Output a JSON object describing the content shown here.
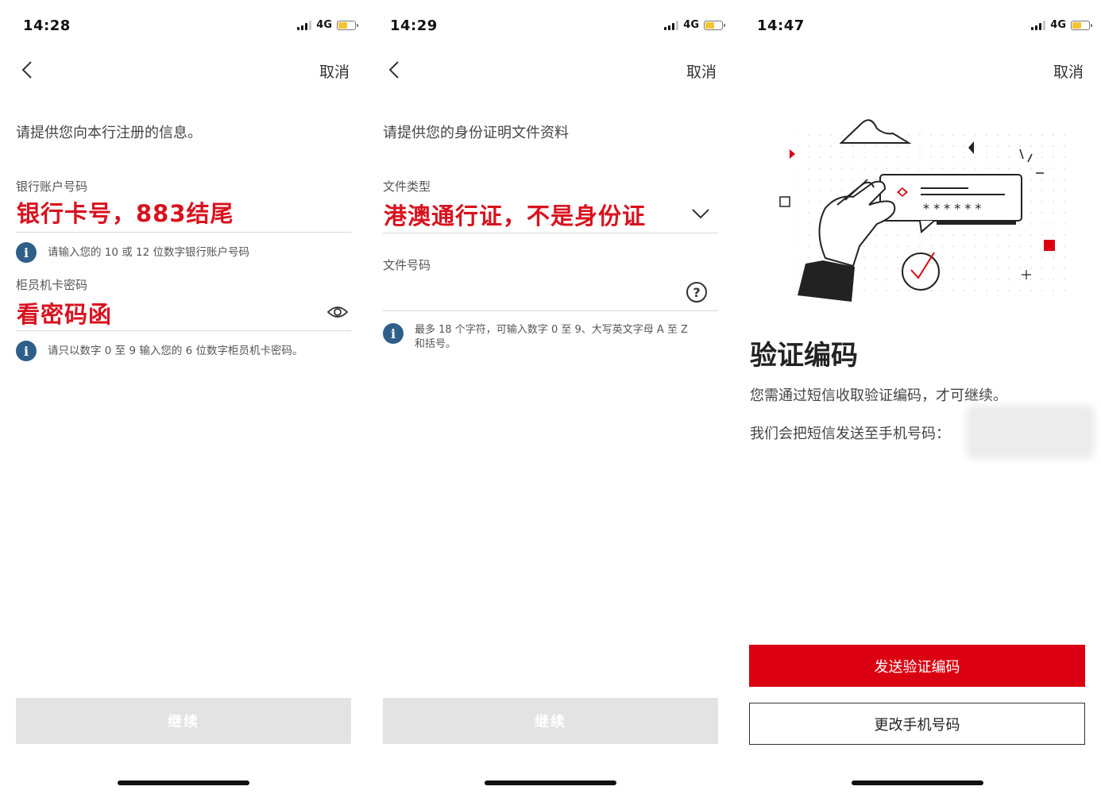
{
  "screens": [
    {
      "status": {
        "time": "14:28",
        "network": "4G"
      },
      "nav": {
        "cancel": "取消"
      },
      "intro": "请提供您向本行注册的信息。",
      "account": {
        "label": "银行账户号码",
        "value": "银行卡号，883结尾",
        "hint": "请输入您的 10 或 12 位数字银行账户号码"
      },
      "pin": {
        "label": "柜员机卡密码",
        "value": "看密码函",
        "hint": "请只以数字 0 至 9 输入您的 6 位数字柜员机卡密码。"
      },
      "continue": "继续"
    },
    {
      "status": {
        "time": "14:29",
        "network": "4G"
      },
      "nav": {
        "cancel": "取消"
      },
      "intro": "请提供您的身份证明文件资料",
      "doc_type": {
        "label": "文件类型",
        "value": "港澳通行证，不是身份证"
      },
      "doc_number": {
        "label": "文件号码",
        "value": "",
        "help": "?",
        "hint_line1": "最多 18 个字符，可输入数字 0 至 9、大写英文字母 A 至 Z",
        "hint_line2": "和括号。"
      },
      "continue": "继续"
    },
    {
      "status": {
        "time": "14:47",
        "network": "4G"
      },
      "nav": {
        "cancel": "取消"
      },
      "title": "验证编码",
      "desc1": "您需通过短信收取验证编码，才可继续。",
      "desc2": "我们会把短信发送至手机号码：",
      "illustration": {
        "masked_code": "* * * * * *"
      },
      "send_button": "发送验证编码",
      "change_button": "更改手机号码"
    }
  ],
  "icons": {
    "back": "chevron-left-icon",
    "info": "info-icon",
    "eye": "eye-icon",
    "dropdown": "chevron-down-icon",
    "help": "question-icon"
  },
  "colors": {
    "accent_red": "#db0011",
    "annotation_red": "#d8121f",
    "info_blue": "#2e5f8a",
    "disabled_button": "#e3e3e3"
  }
}
